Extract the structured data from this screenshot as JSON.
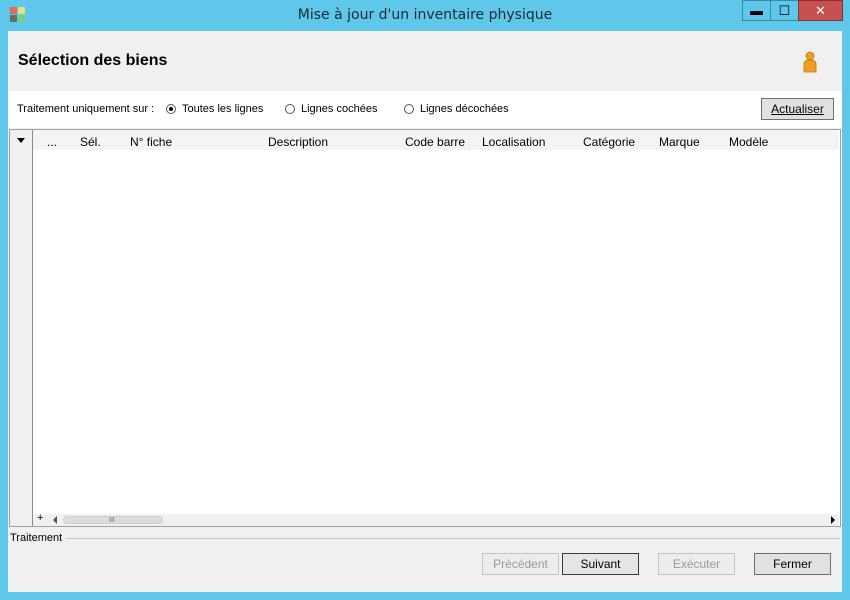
{
  "window": {
    "title": "Mise à jour d'un inventaire physique"
  },
  "titlebar_buttons": {
    "minimize": "▬",
    "maximize": "☐",
    "close": "✕"
  },
  "header": {
    "title": "Sélection des biens",
    "icon": "user-icon"
  },
  "filter": {
    "label": "Traitement uniquement sur :",
    "options": [
      {
        "label": "Toutes les lignes",
        "selected": true
      },
      {
        "label": "Lignes cochées",
        "selected": false
      },
      {
        "label": "Lignes décochées",
        "selected": false
      }
    ],
    "refresh_label": "Actualiser"
  },
  "grid": {
    "columns": [
      "...",
      "Sél.",
      "N° fiche",
      "Description",
      "Code barre",
      "Localisation",
      "Catégorie",
      "Marque",
      "Modèle"
    ],
    "rows": [],
    "scroll_plus": "+",
    "scroll_grip": "III"
  },
  "footer": {
    "group_label": "Traitement",
    "buttons": [
      {
        "label": "Précédent",
        "enabled": false
      },
      {
        "label": "Suivant",
        "enabled": true
      },
      {
        "label": "Exécuter",
        "enabled": false
      },
      {
        "label": "Fermer",
        "enabled": true
      }
    ]
  }
}
